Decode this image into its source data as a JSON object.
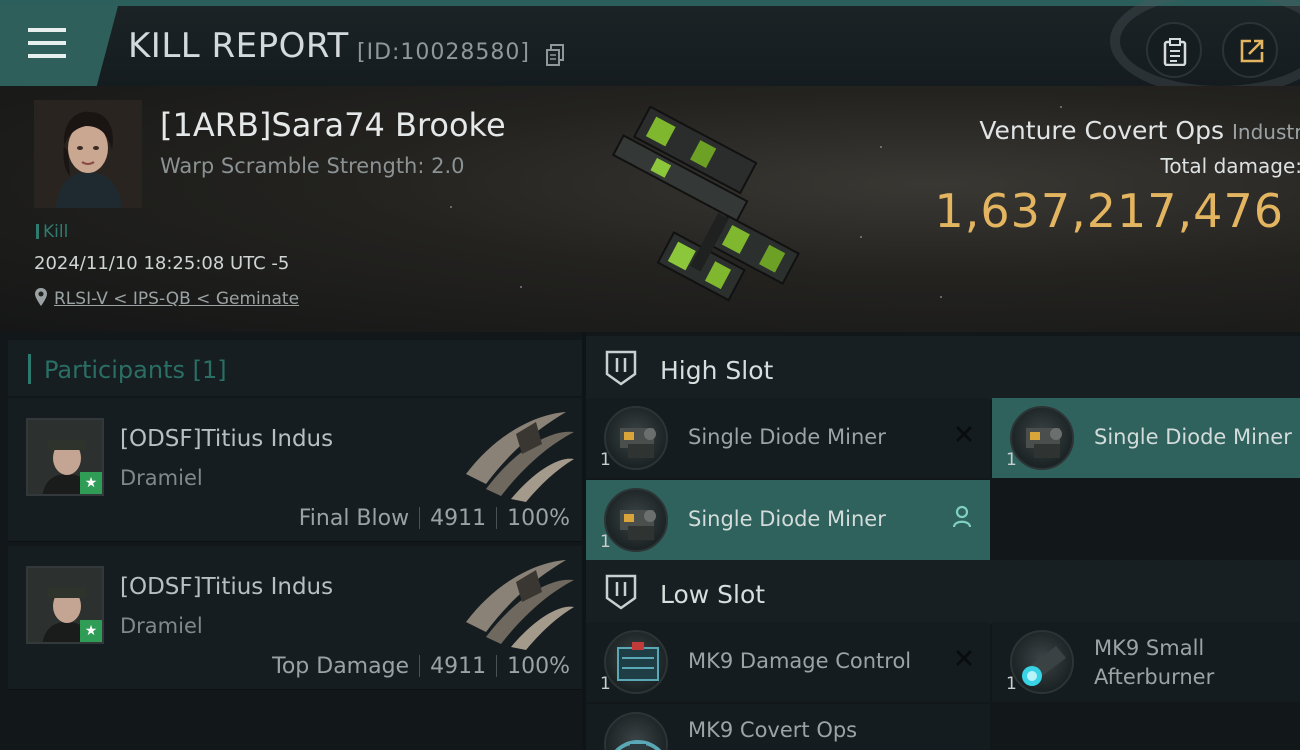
{
  "header": {
    "title": "KILL REPORT",
    "report_id": "[ID:10028580]"
  },
  "victim": {
    "name": "[1ARB]Sara74 Brooke",
    "warp_scramble": "Warp Scramble Strength: 2.0",
    "tag": "Kill",
    "time": "2024/11/10 18:25:08 UTC -5",
    "location": "RLSI-V < IPS-QB < Geminate",
    "ship_name": "Venture Covert Ops",
    "ship_class": "Industri",
    "total_damage_label": "Total damage:",
    "total_damage": "1,637,217,476"
  },
  "participants": {
    "title": "Participants",
    "count": "[1]",
    "rows": [
      {
        "name": "[ODSF]Titius Indus",
        "ship": "Dramiel",
        "role": "Final Blow",
        "damage": "4911",
        "percent": "100%"
      },
      {
        "name": "[ODSF]Titius Indus",
        "ship": "Dramiel",
        "role": "Top Damage",
        "damage": "4911",
        "percent": "100%"
      }
    ]
  },
  "fitting": {
    "high_slot": {
      "title": "High Slot",
      "modules": [
        {
          "name": "Single Diode Miner",
          "qty": "1"
        },
        {
          "name": "Single Diode Miner",
          "qty": "1"
        },
        {
          "name": "Single Diode Miner",
          "qty": "1"
        }
      ]
    },
    "low_slot": {
      "title": "Low Slot",
      "modules": [
        {
          "name": "MK9 Damage Control",
          "qty": "1"
        },
        {
          "name": "MK9 Small Afterburner",
          "qty": "1"
        },
        {
          "name": "MK9 Covert Ops",
          "qty": ""
        }
      ]
    }
  },
  "icons": {
    "menu": "hamburger-menu-icon",
    "copy": "copy-icon",
    "clipboard": "clipboard-icon",
    "share": "share-icon",
    "location": "location-pin-icon",
    "slot": "slot-shield-icon",
    "destroyed": "destroyed-x-icon",
    "dropped": "pilot-icon"
  },
  "colors": {
    "accent_teal": "#2f625d",
    "damage_gold": "#e4b560",
    "final_blow_badge": "#2f9d55"
  }
}
